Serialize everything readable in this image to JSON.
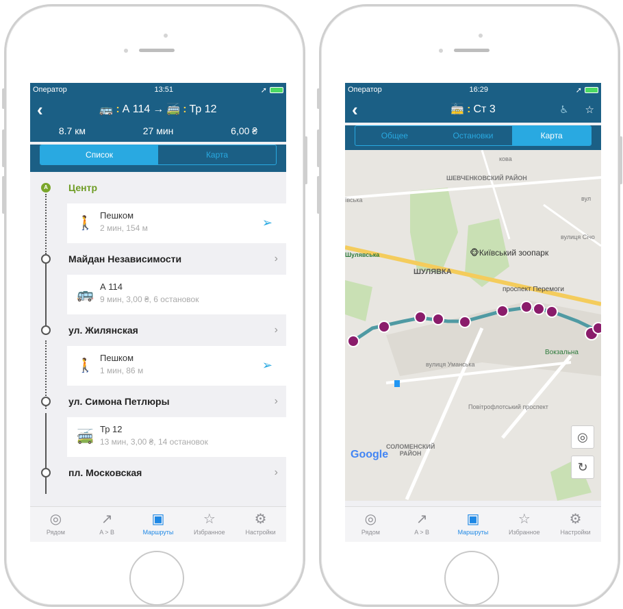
{
  "status": {
    "carrier": "Оператор",
    "left_time": "13:51",
    "right_time": "16:29"
  },
  "left": {
    "title_from": "А 114",
    "title_arrow": "→",
    "title_to": "Тр 12",
    "stats": [
      "8.7 км",
      "27 мин",
      "6,00 ₴"
    ],
    "tabs": [
      "Список",
      "Карта"
    ],
    "start_marker": "A",
    "start_name": "Центр",
    "items": [
      {
        "type": "walk",
        "title": "Пешком",
        "detail": "2 мин, 154 м"
      },
      {
        "type": "stop",
        "name": "Майдан Независимости"
      },
      {
        "type": "bus",
        "title": "А 114",
        "detail": "9 мин, 3,00 ₴, 6 остановок"
      },
      {
        "type": "stop",
        "name": "ул. Жилянская"
      },
      {
        "type": "walk",
        "title": "Пешком",
        "detail": "1 мин, 86 м"
      },
      {
        "type": "stop",
        "name": "ул. Симона Петлюры"
      },
      {
        "type": "trolley",
        "title": "Тр 12",
        "detail": "13 мин, 3,00 ₴, 14 остановок"
      },
      {
        "type": "stop",
        "name": "пл. Московская"
      }
    ]
  },
  "right": {
    "title_route": "Ст 3",
    "tabs": [
      "Общее",
      "Остановки",
      "Карта"
    ],
    "map_labels": {
      "district1": "ШЕВЧЕНКОВСКИЙ\nРАЙОН",
      "zoo": "Київський зоопарк",
      "shulyavka": "ШУЛЯВКА",
      "shulyavska": "Шулявська",
      "prospect": "проспект Перемоги",
      "vokzalna": "Вокзальна",
      "umanska": "вулиця Уманська",
      "povitroflotsky": "Повітрофлотський проспект",
      "district2": "СОЛОМЕНСКИЙ\nРАЙОН",
      "google": "Google",
      "vul_top": "вул",
      "ivska": "ївська",
      "kova": "кова",
      "sichov": "вулиця Січо"
    }
  },
  "tabbar": [
    "Рядом",
    "A > B",
    "Маршруты",
    "Избранное",
    "Настройки"
  ],
  "colors": {
    "header": "#1b5f85",
    "accent": "#29a9e1",
    "active_tab": "#1e88e5",
    "route_line": "#4f9aa3",
    "stop_marker": "#8a1c6b",
    "start_green": "#7aa62a"
  }
}
